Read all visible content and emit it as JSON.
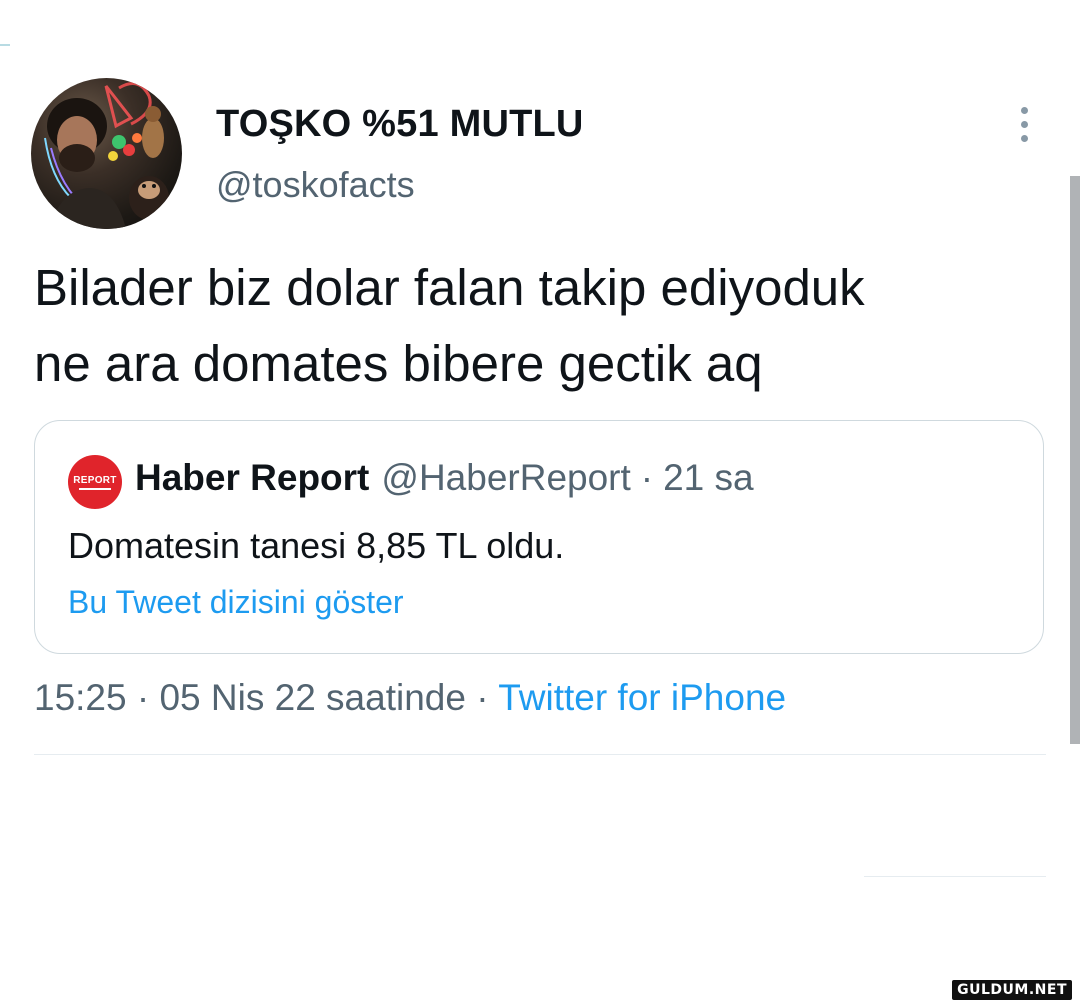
{
  "author": {
    "display_name": "TOŞKO %51 MUTLU",
    "handle": "@toskofacts"
  },
  "tweet": {
    "text_lines": [
      "Bilader biz dolar falan takip ediyoduk",
      "ne ara domates bibere gectik aq"
    ]
  },
  "quoted_tweet": {
    "logo_text": "REPORT",
    "name": "Haber Report",
    "handle": "@HaberReport",
    "separator": "·",
    "time": "21 sa",
    "text": "Domatesin tanesi 8,85 TL oldu.",
    "thread_link": "Bu Tweet dizisini göster"
  },
  "meta": {
    "time_date": "15:25 · 05 Nis 22 saatinde ·",
    "source": "Twitter for iPhone"
  },
  "watermark": "GULDUM.NET",
  "icons": {
    "more": "more-vertical-icon"
  },
  "colors": {
    "link_blue": "#1d9bf0",
    "secondary_text": "#536471",
    "primary_text": "#0f1419",
    "report_red": "#e0242b"
  }
}
